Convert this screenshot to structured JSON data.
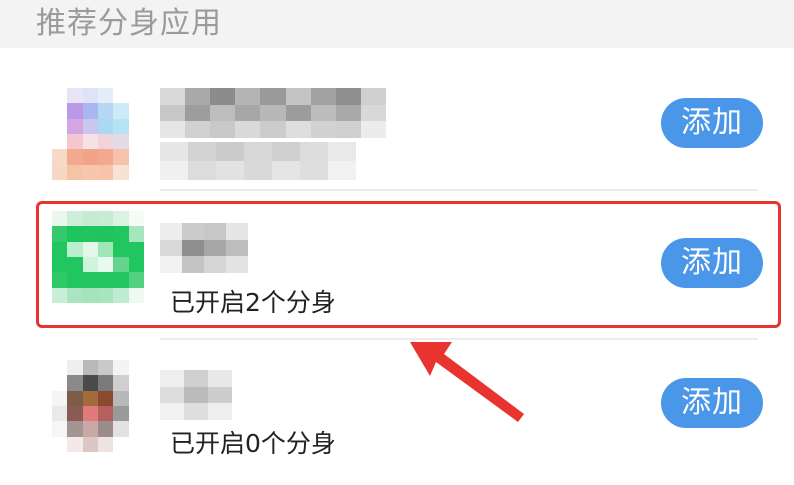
{
  "section": {
    "title": "推荐分身应用"
  },
  "apps": [
    {
      "id": "app-1",
      "name": "",
      "status": "",
      "add_label": "添加"
    },
    {
      "id": "app-2",
      "name": "",
      "status": "已开启2个分身",
      "add_label": "添加",
      "highlighted": true
    },
    {
      "id": "app-3",
      "name": "",
      "status": "已开启0个分身",
      "add_label": "添加"
    }
  ],
  "colors": {
    "accent": "#4a96e8",
    "highlight": "#e8332f",
    "header_text": "#9b9b9b"
  },
  "icons": {
    "app_1": "blurred-app-icon",
    "app_2": "blurred-chat-app-icon",
    "app_3": "blurred-app-icon",
    "annotation": "red-arrow"
  }
}
